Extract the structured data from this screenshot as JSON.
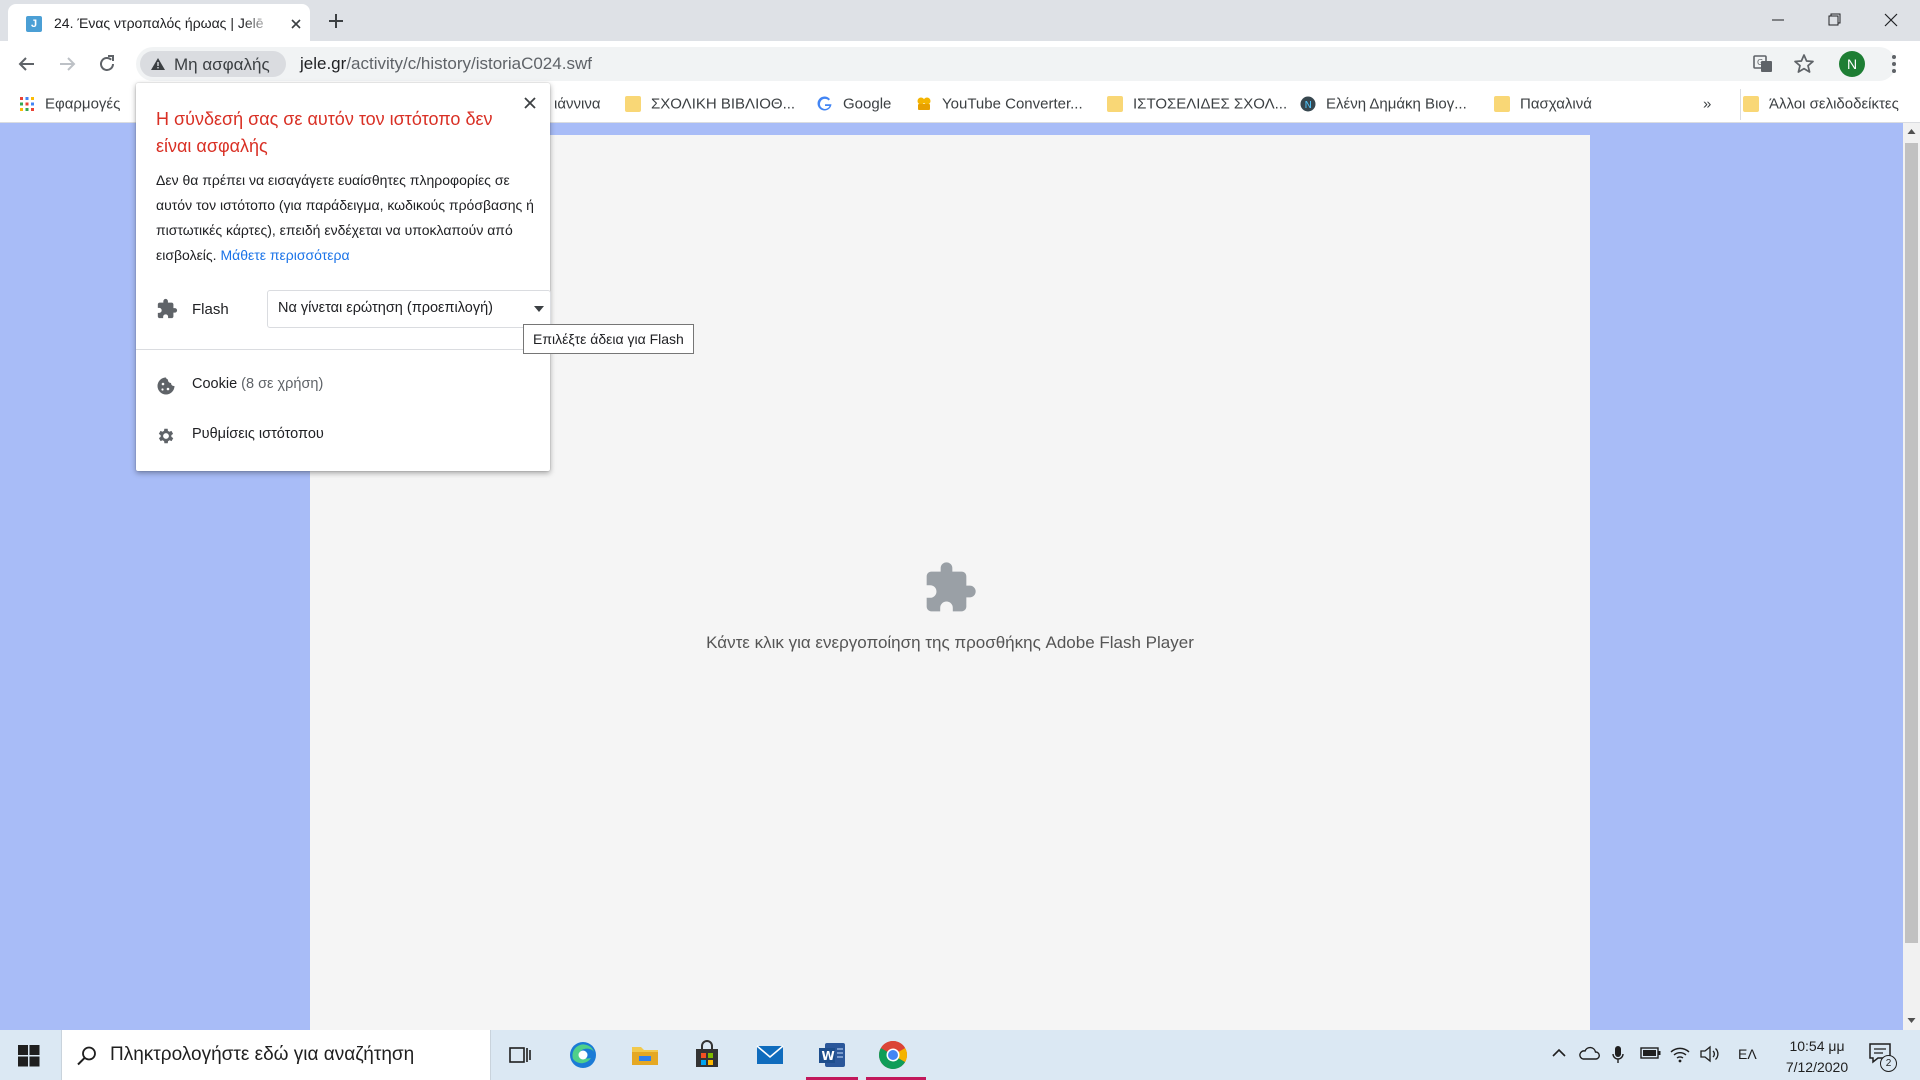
{
  "tab": {
    "favicon_letter": "J",
    "title": "24. Ένας ντροπαλός ήρωας | Jelē"
  },
  "toolbar": {
    "security_label": "Μη ασφαλής",
    "url_host": "jele.gr",
    "url_path": "/activity/c/history/istoriaC024.swf",
    "avatar_letter": "N"
  },
  "bookmarks": {
    "apps_label": "Εφαρμογές",
    "items": [
      {
        "label": "ιάννινα",
        "icon": "folder-icon"
      },
      {
        "label": "ΣΧΟΛΙΚΗ ΒΙΒΛΙΟΘ...",
        "icon": "folder-icon"
      },
      {
        "label": "Google",
        "icon": "google-icon"
      },
      {
        "label": "YouTube Converter...",
        "icon": "converter-icon"
      },
      {
        "label": "ΙΣΤΟΣΕΛΙΔΕΣ ΣΧΟΛ...",
        "icon": "folder-icon"
      },
      {
        "label": "Ελένη Δημάκη Βιογ...",
        "icon": "site-icon"
      },
      {
        "label": "Πασχαλινά",
        "icon": "folder-icon"
      }
    ],
    "overflow_label": "»",
    "other_label": "Άλλοι σελιδοδείκτες"
  },
  "content": {
    "flash_message": "Κάντε κλικ για ενεργοποίηση της προσθήκης Adobe Flash Player"
  },
  "popup": {
    "title": "Η σύνδεσή σας σε αυτόν τον ιστότοπο δεν είναι ασφαλής",
    "body": "Δεν θα πρέπει να εισαγάγετε ευαίσθητες πληροφορίες σε αυτόν τον ιστότοπο (για παράδειγμα, κωδικούς πρόσβασης ή πιστωτικές κάρτες), επειδή ενδέχεται να υποκλαπούν από εισβολείς.",
    "learn_more": "Μάθετε περισσότερα",
    "flash_label": "Flash",
    "flash_value": "Να γίνεται ερώτηση (προεπιλογή)",
    "tooltip": "Επιλέξτε άδεια για Flash",
    "cookie_label": "Cookie",
    "cookie_sub": "(8 σε χρήση)",
    "site_settings": "Ρυθμίσεις ιστότοπου"
  },
  "taskbar": {
    "search_placeholder": "Πληκτρολογήστε εδώ για αναζήτηση",
    "language": "ΕΛ",
    "time": "10:54 μμ",
    "date": "7/12/2020",
    "notification_count": "2"
  },
  "colors": {
    "page_background": "#a8bcf7",
    "warning_title": "#d93025",
    "link": "#1a73e8",
    "avatar": "#1e7e34"
  }
}
